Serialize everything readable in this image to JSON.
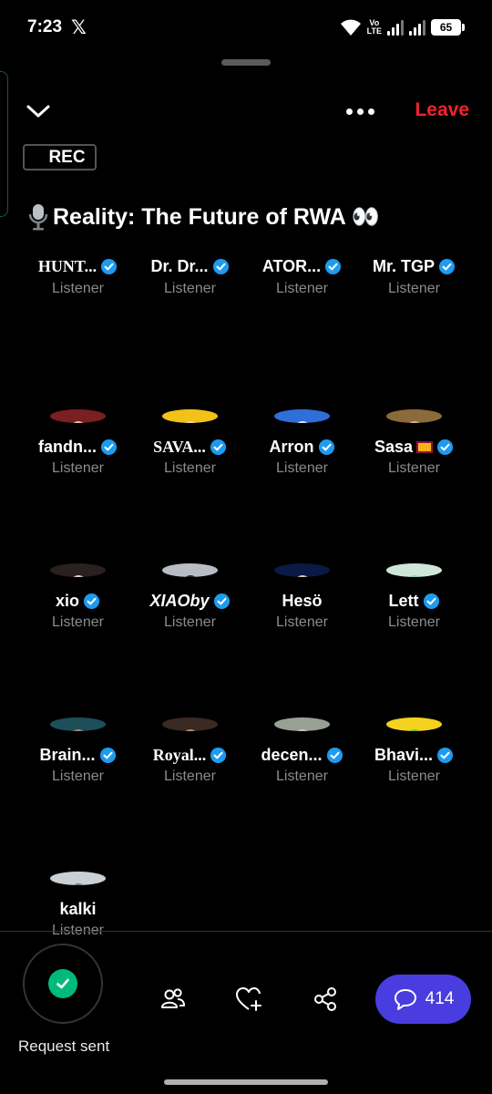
{
  "status_bar": {
    "time": "7:23",
    "app_icon": "x-logo-icon",
    "network_label_top": "Vo",
    "network_label_bottom": "LTE",
    "battery": "65"
  },
  "header": {
    "leave_label": "Leave",
    "rec_label": "REC",
    "title": "Reality: The Future of RWA 👀",
    "title_icon": "microphone-icon"
  },
  "participants": [
    {
      "name": "HUNT...",
      "role": "Listener",
      "verified": true,
      "avatar": "none"
    },
    {
      "name": "Dr. Dr...",
      "role": "Listener",
      "verified": true,
      "avatar": "none"
    },
    {
      "name": "ATOR...",
      "role": "Listener",
      "verified": true,
      "avatar": "none"
    },
    {
      "name": "Mr. TGP",
      "role": "Listener",
      "verified": true,
      "avatar": "none"
    },
    {
      "name": "fandn...",
      "role": "Listener",
      "verified": true,
      "avatar": "anime-girl-avatar"
    },
    {
      "name": "SAVA...",
      "role": "Listener",
      "verified": true,
      "avatar": "sunglasses-anime-avatar"
    },
    {
      "name": "Arron",
      "role": "Listener",
      "verified": true,
      "avatar": "blue-anime-avatar"
    },
    {
      "name": "Sasa",
      "role": "Listener",
      "verified": true,
      "avatar": "street-photo-avatar",
      "flag": "sri-lanka-flag"
    },
    {
      "name": "xio",
      "role": "Listener",
      "verified": true,
      "avatar": "girl-photo-avatar"
    },
    {
      "name": "XIAOby",
      "role": "Listener",
      "verified": true,
      "avatar": "hooded-figure-avatar"
    },
    {
      "name": "Hesö",
      "role": "Listener",
      "verified": false,
      "avatar": "blue-ring-anime-avatar"
    },
    {
      "name": "Lett",
      "role": "Listener",
      "verified": true,
      "avatar": "cartoon-creature-avatar"
    },
    {
      "name": "Brain...",
      "role": "Listener",
      "verified": true,
      "avatar": "headset-man-avatar"
    },
    {
      "name": "Royal...",
      "role": "Listener",
      "verified": true,
      "avatar": "bearded-man-avatar"
    },
    {
      "name": "decen...",
      "role": "Listener",
      "verified": true,
      "avatar": "man-photo-avatar"
    },
    {
      "name": "Bhavi...",
      "role": "Listener",
      "verified": true,
      "avatar": "green-dino-avatar"
    },
    {
      "name": "kalki",
      "role": "Listener",
      "verified": false,
      "avatar": "default-profile-avatar"
    }
  ],
  "bottom": {
    "request_label": "Request sent",
    "comments_count": "414"
  },
  "colors": {
    "background": "#000000",
    "leave": "#f4212e",
    "verified": "#1d9bf0",
    "role_text": "#8b8b8b",
    "comments_button": "#4a3de0",
    "request_check": "#00ba7c"
  }
}
